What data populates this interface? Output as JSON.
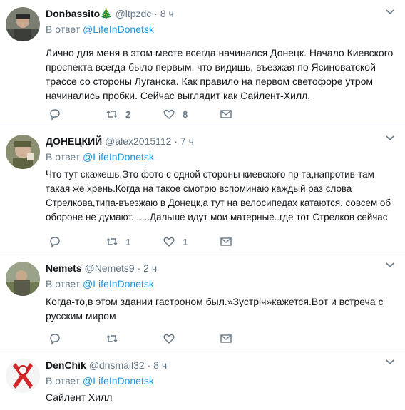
{
  "reply_prefix": "В ответ",
  "tweets": [
    {
      "name": "Donbassito🎄",
      "handle": "@ltpzdc",
      "dot": "·",
      "time": "8 ч",
      "reply_to": "@LifeInDonetsk",
      "text": "Лично для меня в этом месте всегда начинался Донецк. Начало Киевского проспекта всегда было первым, что видишь, въезжая по Ясиноватской трассе со стороны Луганска. Как правило на первом светофоре утром начинались пробки. Сейчас выглядит как Сайлент-Хилл.",
      "replies": "",
      "retweets": "2",
      "likes": "8"
    },
    {
      "name": "ДОНЕЦКИЙ",
      "handle": "@alex2015112",
      "dot": "·",
      "time": "7 ч",
      "reply_to": "@LifeInDonetsk",
      "text": "Что тут скажешь.Это фото с одной стороны киевского пр-та,напротив-там такая же хрень.Когда на такое смотрю вспоминаю каждый раз слова Стрелкова,типа-въезжаю в Донецк,а тут на велосипедах катаются, совсем об обороне не думают.......Дальше идут мои матерные..где тот Стрелков сейчас",
      "replies": "",
      "retweets": "1",
      "likes": "1"
    },
    {
      "name": "Nemets",
      "handle": "@Nemets9",
      "dot": "·",
      "time": "2 ч",
      "reply_to": "@LifeInDonetsk",
      "text": "Когда-то,в этом здании гастроном был.»Зустріч»кажется.Вот и встреча с русским миром",
      "replies": "",
      "retweets": "",
      "likes": ""
    },
    {
      "name": "DenChik",
      "handle": "@dnsmail32",
      "dot": "·",
      "time": "8 ч",
      "reply_to": "@LifeInDonetsk",
      "text": "Сайлент Хилл",
      "replies": "",
      "retweets": "",
      "likes": ""
    }
  ],
  "colors": {
    "link": "#1b95e0",
    "muted": "#657786",
    "text": "#14171a",
    "border": "#e6ecf0"
  },
  "icons": [
    "chevron-down-icon",
    "reply-icon",
    "retweet-icon",
    "like-icon",
    "dm-icon"
  ]
}
